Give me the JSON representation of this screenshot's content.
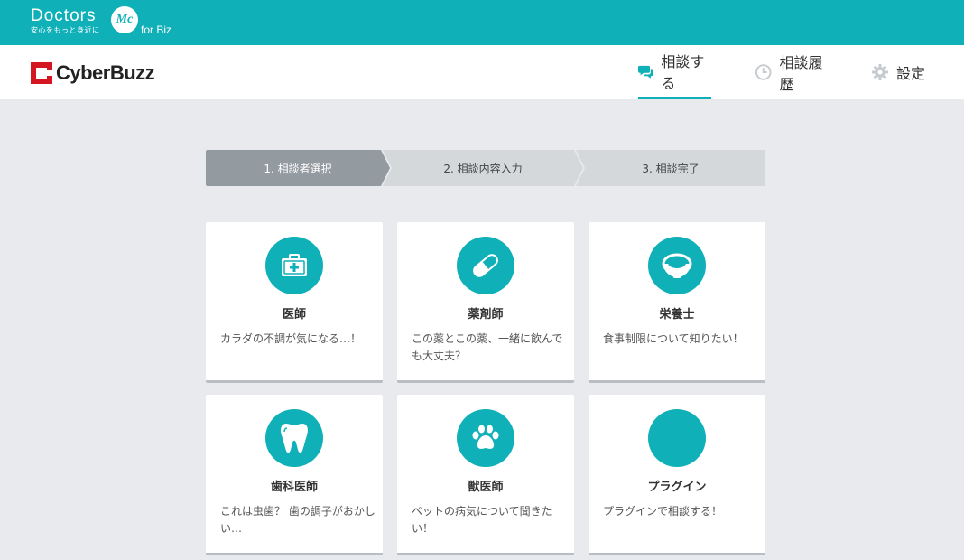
{
  "topbar": {
    "brand_name": "Doctors",
    "brand_tagline": "安心をもっと身近に",
    "brand_mark": "Mc",
    "brand_suffix": "for Biz"
  },
  "header": {
    "logo_text": "CyberBuzz",
    "nav": [
      {
        "label": "相談する",
        "icon": "chat-bubbles-icon",
        "active": true
      },
      {
        "label": "相談履歴",
        "icon": "clock-icon",
        "active": false
      },
      {
        "label": "設定",
        "icon": "gear-icon",
        "active": false
      }
    ]
  },
  "steps": [
    {
      "label": "1. 相談者選択",
      "active": true
    },
    {
      "label": "2. 相談内容入力",
      "active": false
    },
    {
      "label": "3. 相談完了",
      "active": false
    }
  ],
  "cards": [
    {
      "title": "医師",
      "desc": "カラダの不調が気になる…！",
      "icon": "medical-kit-icon"
    },
    {
      "title": "薬剤師",
      "desc": "この薬とこの薬、一緒に飲んでも大丈夫？",
      "icon": "pill-icon"
    },
    {
      "title": "栄養士",
      "desc": "食事制限について知りたい！",
      "icon": "dish-icon"
    },
    {
      "title": "歯科医師",
      "desc": "これは虫歯？ 歯の調子がおかしい…",
      "icon": "tooth-icon"
    },
    {
      "title": "獣医師",
      "desc": "ペットの病気について聞きたい！",
      "icon": "paw-icon"
    },
    {
      "title": "プラグイン",
      "desc": "プラグインで相談する！",
      "icon": "plugin-icon"
    }
  ],
  "colors": {
    "accent": "#0fb0b8",
    "background": "#e8eaed",
    "step_active": "#939ba1",
    "step_inactive": "#d5d8db",
    "logo_red": "#d3161f"
  }
}
